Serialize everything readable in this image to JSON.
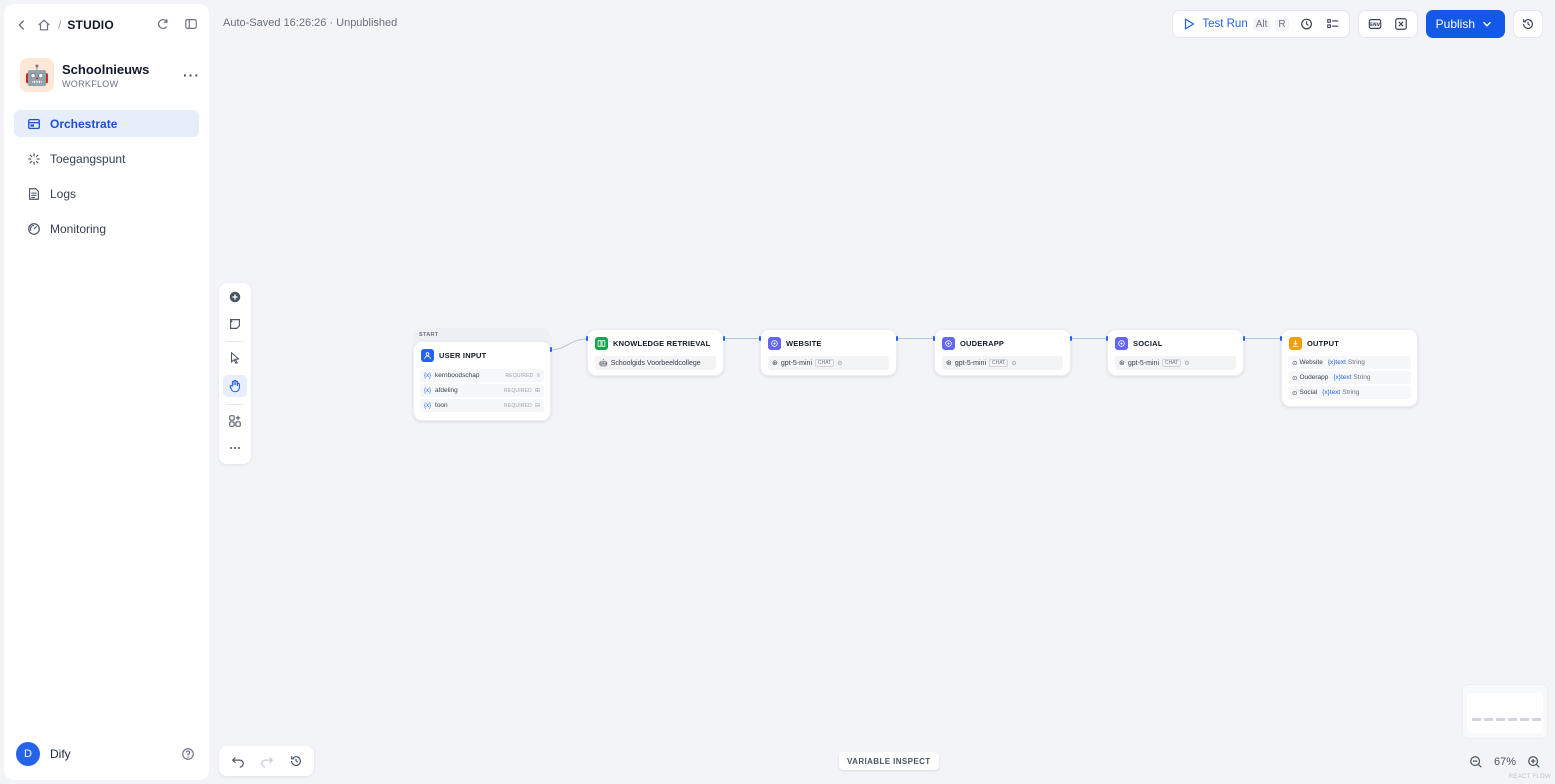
{
  "header": {
    "breadcrumb_root": "STUDIO",
    "autosave": "Auto-Saved 16:26:26 · Unpublished",
    "test_run": "Test Run",
    "test_run_kbd1": "Alt",
    "test_run_kbd2": "R",
    "publish": "Publish"
  },
  "app": {
    "name": "Schoolnieuws",
    "type": "WORKFLOW",
    "avatar": "🤖"
  },
  "nav": {
    "items": [
      {
        "label": "Orchestrate",
        "icon": "orchestrate-icon"
      },
      {
        "label": "Toegangspunt",
        "icon": "access-point-icon"
      },
      {
        "label": "Logs",
        "icon": "logs-icon"
      },
      {
        "label": "Monitoring",
        "icon": "monitoring-icon"
      }
    ]
  },
  "user": {
    "initial": "D",
    "name": "Dify"
  },
  "nodes": {
    "start": {
      "label": "START",
      "title": "USER INPUT",
      "fields": [
        {
          "prefix": "{x}",
          "name": "kernboodschap",
          "req": "REQUIRED"
        },
        {
          "prefix": "{x}",
          "name": "afdeling",
          "req": "REQUIRED"
        },
        {
          "prefix": "{x}",
          "name": "toon",
          "req": "REQUIRED"
        }
      ]
    },
    "knowledge": {
      "title": "KNOWLEDGE RETRIEVAL",
      "body": "Schoolgids Voorbeeldcollege"
    },
    "website": {
      "title": "WEBSITE",
      "model": "gpt-5-mini",
      "tag": "CHAT"
    },
    "ouderapp": {
      "title": "OUDERAPP",
      "model": "gpt-5-mini",
      "tag": "CHAT"
    },
    "social": {
      "title": "SOCIAL",
      "model": "gpt-5-mini",
      "tag": "CHAT"
    },
    "output": {
      "title": "OUTPUT",
      "rows": [
        {
          "node": "Website",
          "var": "{x}text",
          "type": "String"
        },
        {
          "node": "Ouderapp",
          "var": "{x}text",
          "type": "String"
        },
        {
          "node": "Social",
          "var": "{x}text",
          "type": "String"
        }
      ]
    }
  },
  "bottom": {
    "variable_inspect": "VARIABLE INSPECT",
    "zoom": "67%",
    "watermark": "REACT FLOW"
  },
  "colors": {
    "accent": "#1458e8",
    "start": "#2563eb",
    "knowledge": "#16a34a",
    "llm": "#6366f1",
    "output": "#f59e0b"
  }
}
